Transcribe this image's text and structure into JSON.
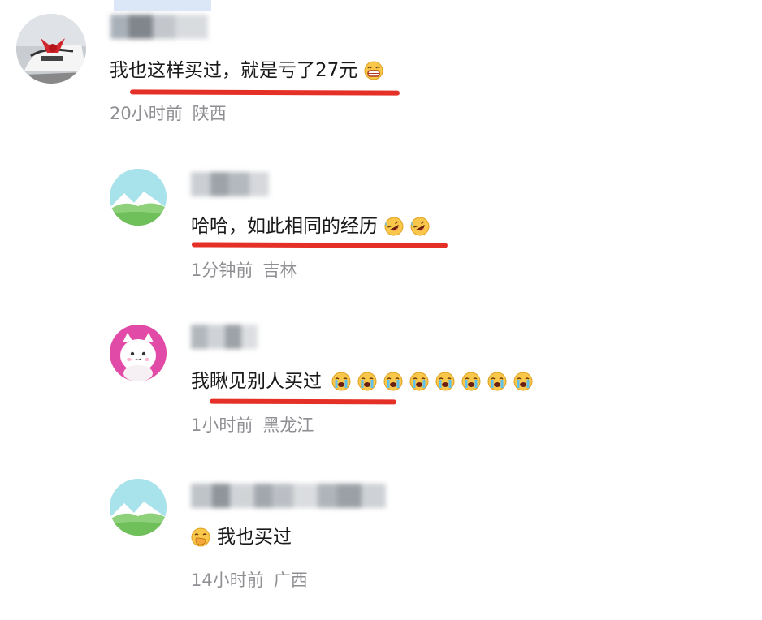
{
  "comments": [
    {
      "text": "我也这样买过，就是亏了27元",
      "time": "20小时前",
      "location": "陕西",
      "emoji": "grin-icon"
    },
    {
      "text": "哈哈，如此相同的经历",
      "time": "1分钟前",
      "location": "吉林",
      "emoji": "rofl-icon"
    },
    {
      "text": "我瞅见别人买过",
      "time": "1小时前",
      "location": "黑龙江",
      "emoji": "crying-icon"
    },
    {
      "text": "我也买过",
      "time": "14小时前",
      "location": "广西",
      "emoji": "hand-over-mouth-icon"
    }
  ],
  "colors": {
    "underline": "#e53027",
    "meta": "#8e8e93",
    "text": "#1a1a1a"
  }
}
